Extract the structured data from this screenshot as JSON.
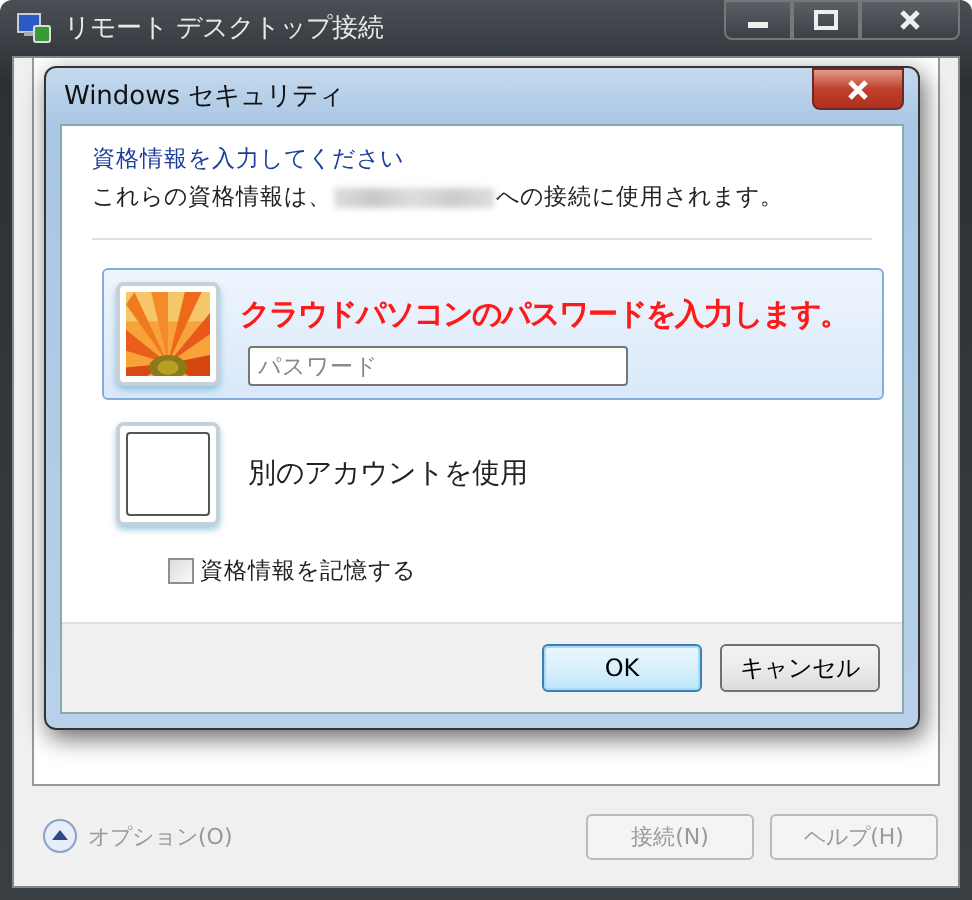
{
  "window": {
    "title": "リモート デスクトップ接続",
    "options": {
      "label": "オプション(O)",
      "disabled": true
    },
    "buttons": [
      {
        "label": "接続(N)",
        "disabled": true
      },
      {
        "label": "ヘルプ(H)",
        "disabled": true
      }
    ]
  },
  "dialog": {
    "title": "Windows セキュリティ",
    "heading": "資格情報を入力してください",
    "message_before": "これらの資格情報は、",
    "message_after": "への接続に使用されます。",
    "tiles": [
      {
        "kind": "password",
        "selected": true,
        "placeholder": "パスワード"
      },
      {
        "kind": "account",
        "selected": false,
        "label": "別のアカウントを使用"
      }
    ],
    "remember": {
      "label": "資格情報を記憶する",
      "checked": false
    },
    "buttons": [
      {
        "label": "OK",
        "default": true
      },
      {
        "label": "キャンセル",
        "default": false
      }
    ]
  },
  "annotation": "クラウドパソコンのパスワードを入力します。"
}
